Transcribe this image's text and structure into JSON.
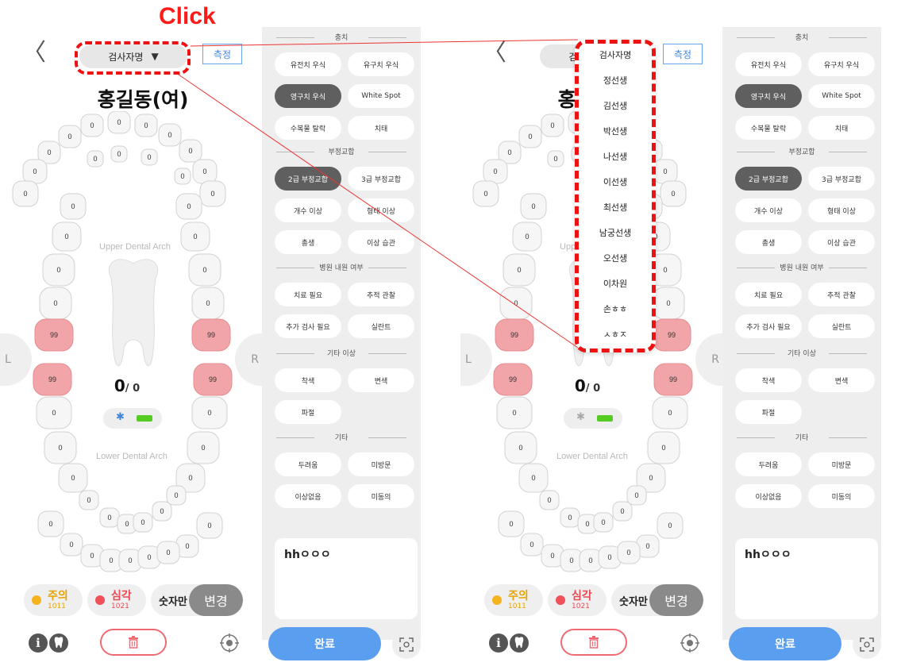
{
  "callout": "Click",
  "header": {
    "back_glyph": "〈",
    "examiner_label": "검사자명",
    "caret": "▼",
    "measure_label": "측정"
  },
  "patient_name": "홍길동(여)",
  "arch": {
    "upper_label": "Upper Dental Arch",
    "lower_label": "Lower Dental Arch"
  },
  "tooth_values": {
    "normal": "0",
    "flagged": "99"
  },
  "side_tabs": {
    "left": "L",
    "right": "R"
  },
  "counter": {
    "value": "0",
    "total": "/ 0"
  },
  "status": {
    "caution_label": "주의",
    "caution_count": "1011",
    "severe_label": "심각",
    "severe_count": "1021",
    "numbers_only": "숫자만",
    "change": "변경"
  },
  "bottom": {
    "info_glyph": "i"
  },
  "panel": {
    "sections": [
      {
        "title": "충치",
        "chips": [
          {
            "label": "유전치 우식",
            "selected": false
          },
          {
            "label": "유구치 우식",
            "selected": false
          },
          {
            "label": "영구치 우식",
            "selected": true
          },
          {
            "label": "White Spot",
            "selected": false
          },
          {
            "label": "수복물 탈락",
            "selected": false
          },
          {
            "label": "치태",
            "selected": false
          }
        ]
      },
      {
        "title": "부정교합",
        "chips": [
          {
            "label": "2급 부정교합",
            "selected": true
          },
          {
            "label": "3급 부정교합",
            "selected": false
          },
          {
            "label": "개수 이상",
            "selected": false
          },
          {
            "label": "형태 이상",
            "selected": false
          },
          {
            "label": "총생",
            "selected": false
          },
          {
            "label": "이상 습관",
            "selected": false
          }
        ]
      },
      {
        "title": "병원 내원 여부",
        "chips": [
          {
            "label": "치료 필요",
            "selected": false
          },
          {
            "label": "추적 관찰",
            "selected": false
          },
          {
            "label": "추가 검사 필요",
            "selected": false
          },
          {
            "label": "실란트",
            "selected": false
          }
        ]
      },
      {
        "title": "기타 이상",
        "chips": [
          {
            "label": "착색",
            "selected": false
          },
          {
            "label": "변색",
            "selected": false
          },
          {
            "label": "파절",
            "selected": false
          }
        ]
      },
      {
        "title": "기타",
        "chips": [
          {
            "label": "두려움",
            "selected": false
          },
          {
            "label": "미방문",
            "selected": false
          },
          {
            "label": "이상없음",
            "selected": false
          },
          {
            "label": "미동의",
            "selected": false
          }
        ]
      }
    ],
    "memo": "hhㅇㅇㅇ",
    "done": "완료"
  },
  "dropdown": {
    "options": [
      "검사자명",
      "정선생",
      "김선생",
      "박선생",
      "나선생",
      "이선생",
      "최선생",
      "남궁선생",
      "오선생",
      "이차원",
      "손ㅎㅎ",
      "ㅅㅎㅈ"
    ]
  },
  "colors": {
    "accent": "#5a9ef0",
    "flagged": "#f2a5a8",
    "selected_chip": "#5f5f5f",
    "highlight": "#ee1111"
  }
}
